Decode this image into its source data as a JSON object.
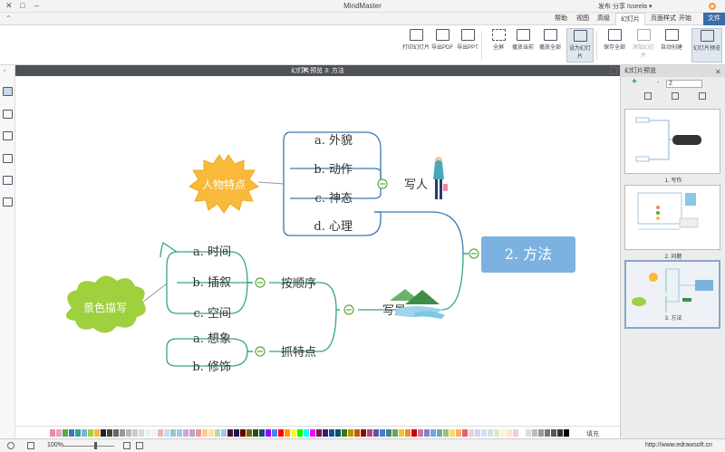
{
  "window": {
    "title": "MindMaster",
    "minimize": "–",
    "maximize": "□",
    "close": "✕"
  },
  "quick_access": {
    "label": "发布  分享  Isseela ▾"
  },
  "tabs": [
    {
      "label": "文件",
      "key": "file"
    },
    {
      "label": "开始",
      "key": "start"
    },
    {
      "label": "页面样式",
      "key": "page"
    },
    {
      "label": "幻灯片",
      "key": "slides"
    },
    {
      "label": "高级",
      "key": "advanced"
    },
    {
      "label": "视图",
      "key": "view"
    },
    {
      "label": "帮助",
      "key": "help"
    }
  ],
  "ribbon_buttons": [
    {
      "label": "幻灯片预览",
      "key": "preview"
    },
    {
      "label": "自动创建",
      "key": "auto"
    },
    {
      "label": "添加幻灯片",
      "key": "add"
    },
    {
      "label": "保存全部",
      "key": "saveall"
    },
    {
      "label": "设为幻灯片",
      "key": "set"
    },
    {
      "label": "播放全部",
      "key": "play"
    },
    {
      "label": "播放当前",
      "key": "playcur"
    },
    {
      "label": "全屏",
      "key": "full"
    },
    {
      "label": "导出PPT",
      "key": "ppt"
    },
    {
      "label": "导出PDF",
      "key": "pdf"
    },
    {
      "label": "打印幻灯片",
      "key": "print"
    }
  ],
  "document_tab": {
    "title": "幻灯片预览 3: 方法",
    "close": "✕"
  },
  "right_panel": {
    "title": "幻灯片预览",
    "close": "✕",
    "count_value": "2",
    "add_symbol": "+",
    "remove_symbol": "-",
    "thumbnails": [
      {
        "caption": "1. 写作"
      },
      {
        "caption": "2. 问题"
      },
      {
        "caption": "3. 方法"
      }
    ]
  },
  "mindmap": {
    "central": "2. 方法",
    "branch_person": "写人",
    "person_items": [
      "a. 外貌",
      "b. 动作",
      "c. 神态",
      "d. 心理"
    ],
    "person_callout": "人物特点",
    "branch_scene": "写景",
    "scene_order": "按顺序",
    "scene_order_items": [
      "a. 时间",
      "b. 插叙",
      "c. 空间"
    ],
    "scene_feature": "抓特点",
    "scene_feature_items": [
      "a. 想象",
      "b. 修饰"
    ],
    "scene_callout": "景色描写"
  },
  "colors": {
    "accent": "#3a6da8",
    "central_fill": "#7bb2df",
    "line_blue": "#3a79b7",
    "line_teal": "#34a38a",
    "collapse_green": "#5aa83b",
    "callout_orange": "#f9b93b",
    "callout_green": "#9fd03e"
  },
  "palette_label": "填充",
  "status": {
    "url": "http://www.edrawsoft.cn",
    "zoom": "100%"
  }
}
